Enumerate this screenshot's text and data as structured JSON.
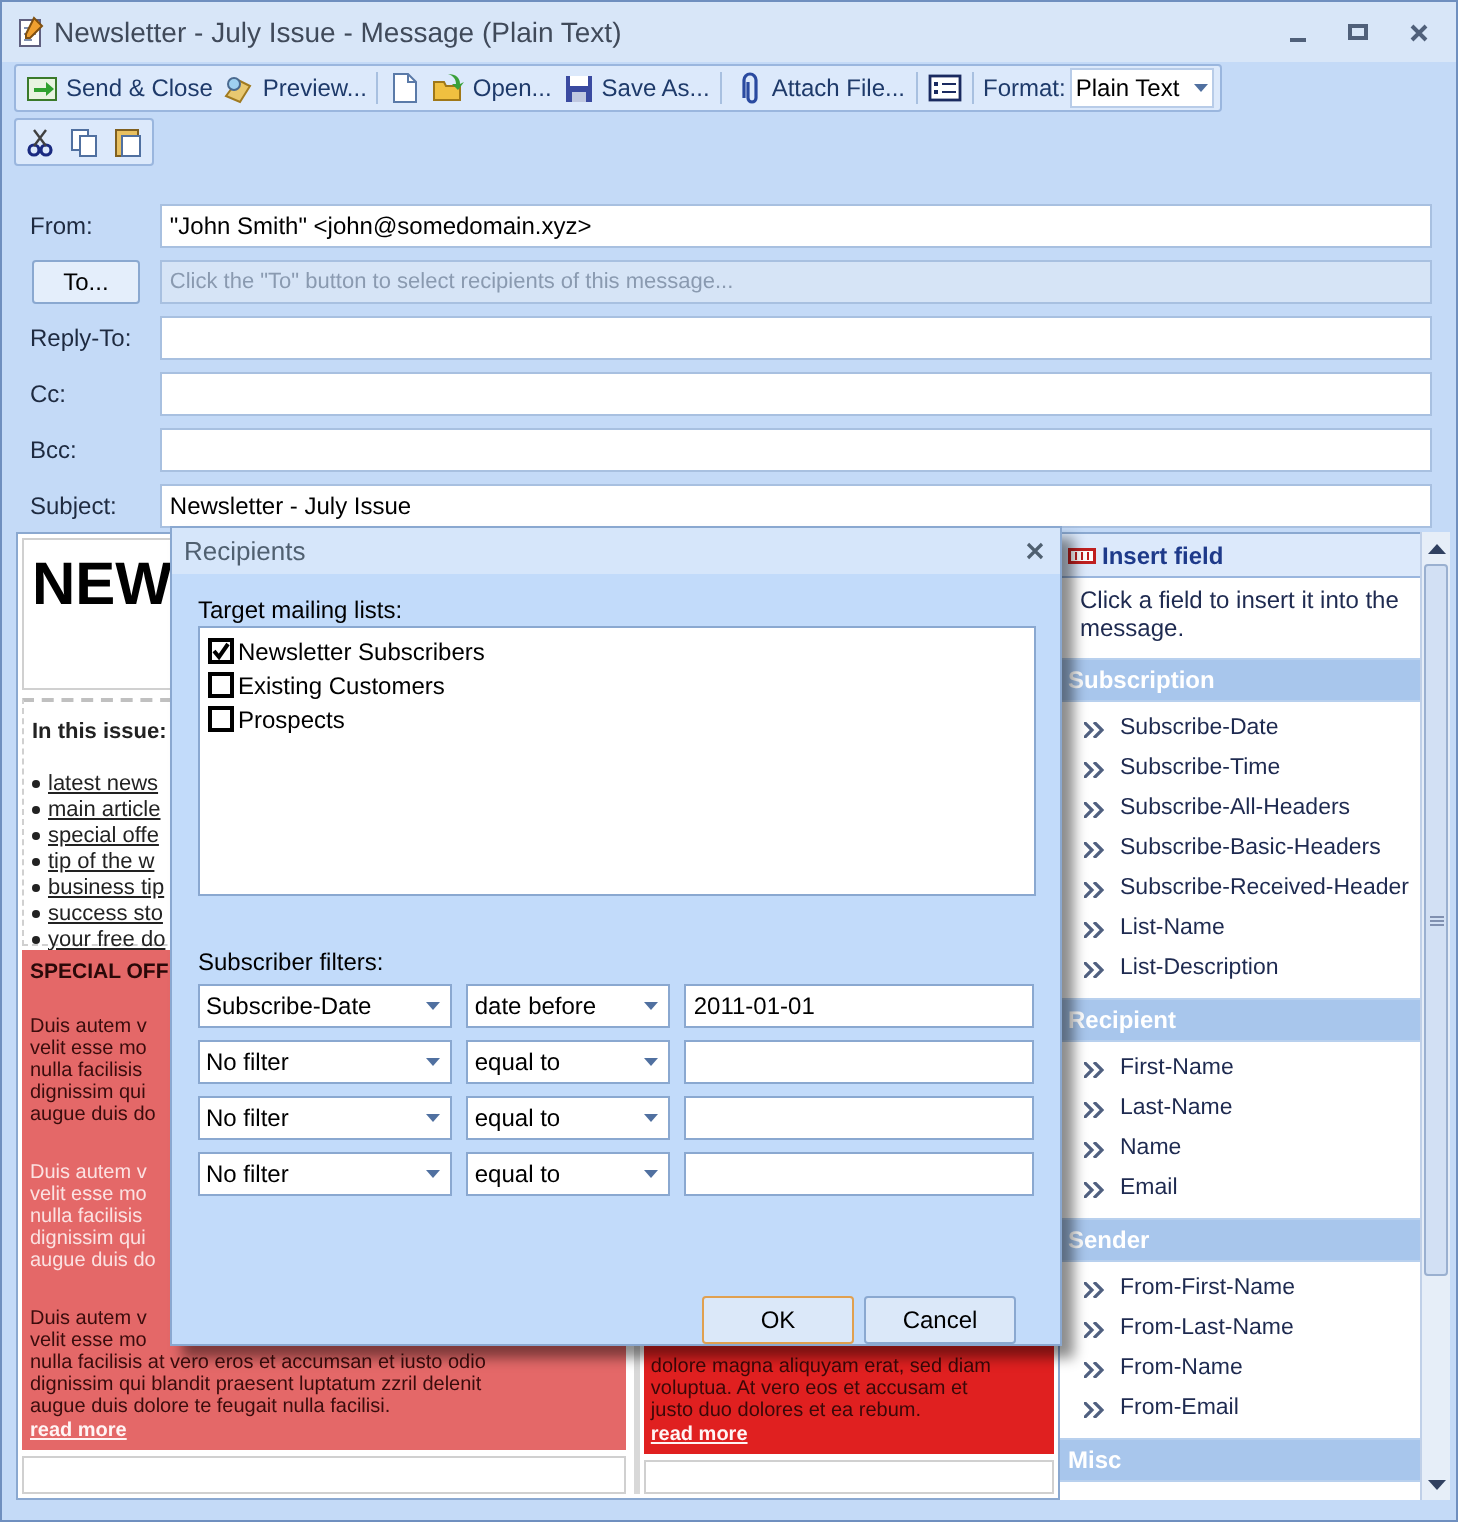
{
  "window": {
    "title": "Newsletter - July Issue - Message (Plain Text)"
  },
  "toolbar": [
    {
      "kind": "send",
      "label": "Send & Close"
    },
    {
      "kind": "preview",
      "label": "Preview..."
    },
    {
      "kind": "new"
    },
    {
      "kind": "open",
      "label": "Open..."
    },
    {
      "kind": "save",
      "label": "Save As..."
    },
    {
      "kind": "attach",
      "label": "Attach File..."
    },
    {
      "kind": "form"
    }
  ],
  "format": {
    "label": "Format:",
    "value": "Plain Text"
  },
  "fields": [
    {
      "kind": "text",
      "label": "From:",
      "value": "\"John Smith\" <john@somedomain.xyz>"
    },
    {
      "kind": "button",
      "label": "To...",
      "placeholder": "Click the \"To\" button to select recipients of this message..."
    },
    {
      "kind": "text",
      "label": "Reply-To:"
    },
    {
      "kind": "text",
      "label": "Cc:"
    },
    {
      "kind": "text",
      "label": "Bcc:"
    },
    {
      "kind": "text",
      "label": "Subject:",
      "value": "Newsletter - July Issue"
    }
  ],
  "newsletter": {
    "masthead": "NEW",
    "issue_heading": "In this issue:",
    "issue_links": [
      "latest news",
      "main article",
      "special offe",
      "tip of the w",
      "business tip",
      "success sto",
      "your free do"
    ],
    "offer_heading": "SPECIAL OFF",
    "paragraphs": [
      {
        "kind": "dark",
        "lines": [
          "Duis autem v",
          "velit esse mo",
          "nulla facilisis",
          "dignissim qui",
          "augue duis do"
        ]
      },
      {
        "kind": "light",
        "lines": [
          "Duis autem v",
          "velit esse mo",
          "nulla facilisis",
          "dignissim qui",
          "augue duis do"
        ]
      },
      {
        "kind": "dark",
        "lines": [
          "Duis autem v",
          "velit esse mo",
          "nulla facilisis at vero eros et accumsan et iusto odio",
          "dignissim qui blandit praesent luptatum zzril delenit",
          "augue duis dolore te feugait nulla facilisi."
        ]
      }
    ],
    "read_more": "read more",
    "right_paragraph": [
      "dolore magna aliquyam erat, sed diam",
      "voluptua. At vero eos et accusam et",
      "justo duo dolores et ea rebum."
    ],
    "right_read_more": "read more"
  },
  "dialog": {
    "title": "Recipients",
    "lists_label": "Target mailing lists:",
    "lists": [
      {
        "label": "Newsletter Subscribers",
        "checked": true
      },
      {
        "label": "Existing Customers",
        "checked": false
      },
      {
        "label": "Prospects",
        "checked": false
      }
    ],
    "filters_label": "Subscriber filters:",
    "filters": [
      {
        "field": "Subscribe-Date",
        "operator": "date before",
        "value": "2011-01-01"
      },
      {
        "field": "No filter",
        "operator": "equal to"
      },
      {
        "field": "No filter",
        "operator": "equal to"
      },
      {
        "field": "No filter",
        "operator": "equal to"
      }
    ],
    "buttons": [
      "OK",
      "Cancel"
    ]
  },
  "insert_panel": {
    "title": "Insert field",
    "description": "Click a field to insert it into the message.",
    "groups": [
      {
        "name": "Subscription",
        "items": [
          "Subscribe-Date",
          "Subscribe-Time",
          "Subscribe-All-Headers",
          "Subscribe-Basic-Headers",
          "Subscribe-Received-Header",
          "List-Name",
          "List-Description"
        ]
      },
      {
        "name": "Recipient",
        "items": [
          "First-Name",
          "Last-Name",
          "Name",
          "Email"
        ]
      },
      {
        "name": "Sender",
        "items": [
          "From-First-Name",
          "From-Last-Name",
          "From-Name",
          "From-Email"
        ]
      },
      {
        "name": "Misc"
      }
    ]
  }
}
